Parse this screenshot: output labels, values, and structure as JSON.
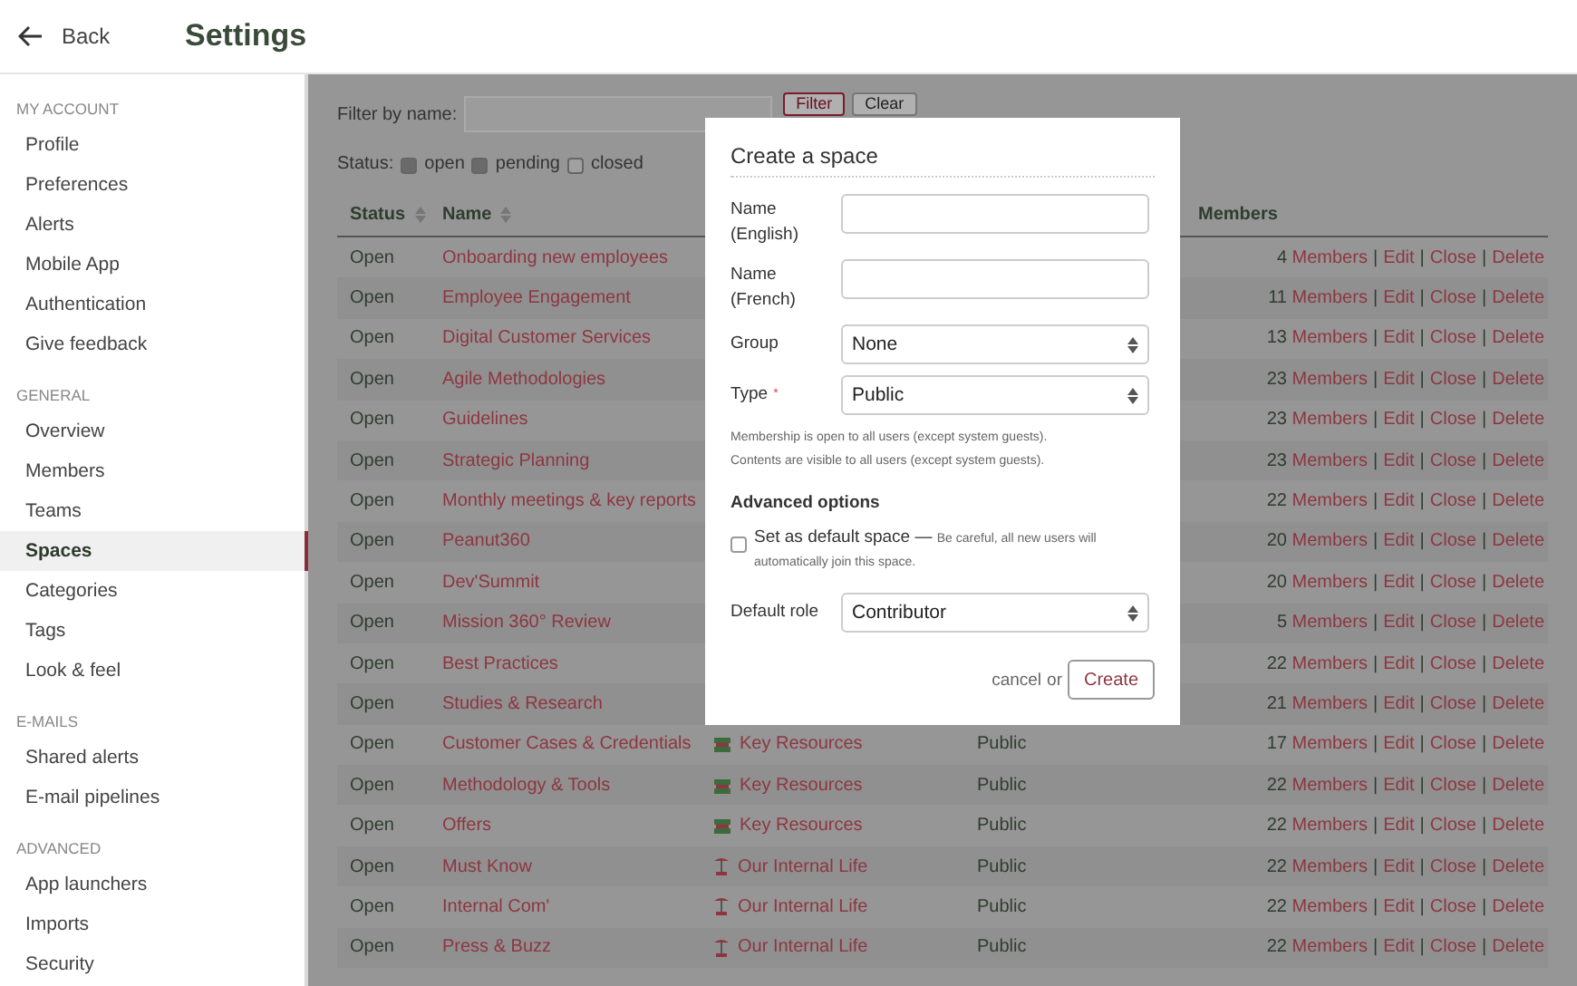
{
  "header": {
    "back": "Back",
    "title": "Settings"
  },
  "sidebar": {
    "sections": [
      {
        "title": "MY ACCOUNT",
        "items": [
          {
            "label": "Profile",
            "selected": false
          },
          {
            "label": "Preferences",
            "selected": false
          },
          {
            "label": "Alerts",
            "selected": false
          },
          {
            "label": "Mobile App",
            "selected": false
          },
          {
            "label": "Authentication",
            "selected": false
          },
          {
            "label": "Give feedback",
            "selected": false
          }
        ]
      },
      {
        "title": "GENERAL",
        "items": [
          {
            "label": "Overview",
            "selected": false
          },
          {
            "label": "Members",
            "selected": false
          },
          {
            "label": "Teams",
            "selected": false
          },
          {
            "label": "Spaces",
            "selected": true
          },
          {
            "label": "Categories",
            "selected": false
          },
          {
            "label": "Tags",
            "selected": false
          },
          {
            "label": "Look & feel",
            "selected": false
          }
        ]
      },
      {
        "title": "E-MAILS",
        "items": [
          {
            "label": "Shared alerts",
            "selected": false
          },
          {
            "label": "E-mail pipelines",
            "selected": false
          }
        ]
      },
      {
        "title": "ADVANCED",
        "items": [
          {
            "label": "App launchers",
            "selected": false
          },
          {
            "label": "Imports",
            "selected": false
          },
          {
            "label": "Security",
            "selected": false
          }
        ]
      }
    ]
  },
  "filter": {
    "label": "Filter by name:",
    "buttons": [
      "Filter",
      "Clear"
    ],
    "status_label": "Status:",
    "statuses": [
      {
        "label": "open",
        "checked": true
      },
      {
        "label": "pending",
        "checked": true
      },
      {
        "label": "closed",
        "checked": false
      }
    ]
  },
  "table": {
    "columns": [
      "Status",
      "Name",
      "Members"
    ],
    "rows": [
      {
        "status": "Open",
        "name": "Onboarding new employees",
        "members": "4",
        "actions": [
          "Members",
          "|",
          "Edit",
          "|",
          "Close",
          "|",
          "Delete"
        ]
      },
      {
        "status": "Open",
        "name": "Employee Engagement",
        "members": "11",
        "actions": [
          "Members",
          "|",
          "Edit",
          "|",
          "Close",
          "|",
          "Delete"
        ]
      },
      {
        "status": "Open",
        "name": "Digital Customer Services",
        "members": "13",
        "actions": [
          "Members",
          "|",
          "Edit",
          "|",
          "Close",
          "|",
          "Delete"
        ]
      },
      {
        "status": "Open",
        "name": "Agile Methodologies",
        "members": "23",
        "actions": [
          "Members",
          "|",
          "Edit",
          "|",
          "Close",
          "|",
          "Delete"
        ]
      },
      {
        "status": "Open",
        "name": "Guidelines",
        "members": "23",
        "actions": [
          "Members",
          "|",
          "Edit",
          "|",
          "Close",
          "|",
          "Delete"
        ]
      },
      {
        "status": "Open",
        "name": "Strategic Planning",
        "members": "23",
        "actions": [
          "Members",
          "|",
          "Edit",
          "|",
          "Close",
          "|",
          "Delete"
        ]
      },
      {
        "status": "Open",
        "name": "Monthly meetings & key reports",
        "members": "22",
        "actions": [
          "Members",
          "|",
          "Edit",
          "|",
          "Close",
          "|",
          "Delete"
        ]
      },
      {
        "status": "Open",
        "name": "Peanut360",
        "members": "20",
        "actions": [
          "Members",
          "|",
          "Edit",
          "|",
          "Close",
          "|",
          "Delete"
        ]
      },
      {
        "status": "Open",
        "name": "Dev'Summit",
        "members": "20",
        "actions": [
          "Members",
          "|",
          "Edit",
          "|",
          "Close",
          "|",
          "Delete"
        ]
      },
      {
        "status": "Open",
        "name": "Mission 360° Review",
        "members": "5",
        "actions": [
          "Members",
          "|",
          "Edit",
          "|",
          "Close",
          "|",
          "Delete"
        ]
      },
      {
        "status": "Open",
        "name": "Best Practices",
        "members": "22",
        "actions": [
          "Members",
          "|",
          "Edit",
          "|",
          "Close",
          "|",
          "Delete"
        ]
      },
      {
        "status": "Open",
        "name": "Studies & Research",
        "members": "21",
        "actions": [
          "Members",
          "|",
          "Edit",
          "|",
          "Close",
          "|",
          "Delete"
        ]
      },
      {
        "status": "Open",
        "name": "Customer Cases & Credentials",
        "group": {
          "name": "Key Resources",
          "kind": "stack"
        },
        "type": "Public",
        "members": "17",
        "actions": [
          "Members",
          "|",
          "Edit",
          "|",
          "Close",
          "|",
          "Delete"
        ]
      },
      {
        "status": "Open",
        "name": "Methodology & Tools",
        "group": {
          "name": "Key Resources",
          "kind": "stack"
        },
        "type": "Public",
        "members": "22",
        "actions": [
          "Members",
          "|",
          "Edit",
          "|",
          "Close",
          "|",
          "Delete"
        ]
      },
      {
        "status": "Open",
        "name": "Offers",
        "group": {
          "name": "Key Resources",
          "kind": "stack"
        },
        "type": "Public",
        "members": "22",
        "actions": [
          "Members",
          "|",
          "Edit",
          "|",
          "Close",
          "|",
          "Delete"
        ]
      },
      {
        "status": "Open",
        "name": "Must Know",
        "group": {
          "name": "Our Internal Life",
          "kind": "tree"
        },
        "type": "Public",
        "members": "22",
        "actions": [
          "Members",
          "|",
          "Edit",
          "|",
          "Close",
          "|",
          "Delete"
        ]
      },
      {
        "status": "Open",
        "name": "Internal Com'",
        "group": {
          "name": "Our Internal Life",
          "kind": "tree"
        },
        "type": "Public",
        "members": "22",
        "actions": [
          "Members",
          "|",
          "Edit",
          "|",
          "Close",
          "|",
          "Delete"
        ]
      },
      {
        "status": "Open",
        "name": "Press & Buzz",
        "group": {
          "name": "Our Internal Life",
          "kind": "tree"
        },
        "type": "Public",
        "members": "22",
        "actions": [
          "Members",
          "|",
          "Edit",
          "|",
          "Close",
          "|",
          "Delete"
        ]
      }
    ]
  },
  "dialog": {
    "title": "Create a space",
    "fields": [
      {
        "kind": "input",
        "label": "Name (English)"
      },
      {
        "kind": "input",
        "label": "Name (French)"
      },
      {
        "kind": "select",
        "label": "Group",
        "value": "None"
      },
      {
        "kind": "select",
        "label": "Type",
        "required": "*",
        "value": "Public"
      }
    ],
    "help": [
      "Membership is open to all users (except system guests).",
      "Contents are visible to all users (except system guests)."
    ],
    "advanced_title": "Advanced options",
    "default_space": {
      "checked": false,
      "label": "Set as default space —",
      "hint": "Be careful, all new users will automatically join this space."
    },
    "default_role": {
      "label": "Default role",
      "value": "Contributor"
    },
    "cancel": "cancel",
    "or": "or",
    "create": "Create"
  }
}
